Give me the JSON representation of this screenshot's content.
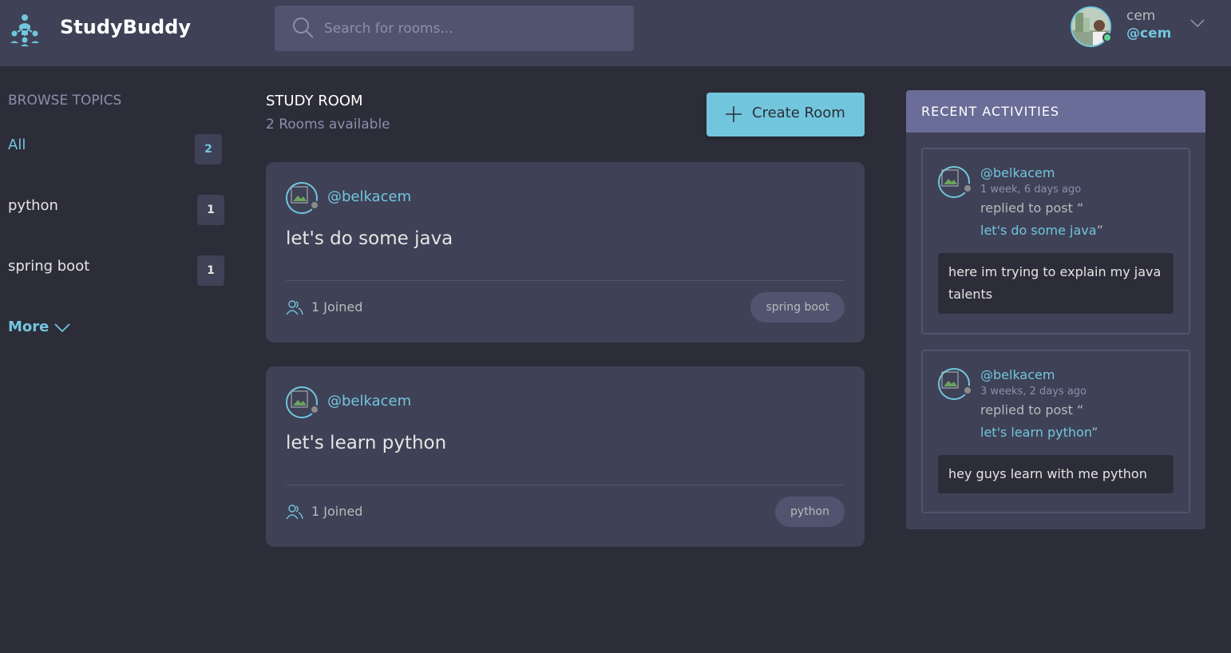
{
  "header": {
    "brand": "StudyBuddy",
    "search_placeholder": "Search for rooms...",
    "user": {
      "name": "cem",
      "handle": "@cem"
    }
  },
  "sidebar": {
    "title": "BROWSE TOPICS",
    "topics": [
      {
        "label": "All",
        "count": "2"
      },
      {
        "label": "python",
        "count": "1"
      },
      {
        "label": "spring boot",
        "count": "1"
      }
    ],
    "more_label": "More"
  },
  "main": {
    "title": "STUDY ROOM",
    "subtitle": "2 Rooms available",
    "create_label": "Create Room",
    "rooms": [
      {
        "host": "@belkacem",
        "name": "let's do some java",
        "joined": "1 Joined",
        "topic": "spring boot"
      },
      {
        "host": "@belkacem",
        "name": "let's learn python",
        "joined": "1 Joined",
        "topic": "python"
      }
    ]
  },
  "activities": {
    "title": "RECENT ACTIVITIES",
    "items": [
      {
        "user": "@belkacem",
        "time": "1 week, 6 days ago",
        "action": "replied to post “",
        "post": "let's do some java",
        "close": "”",
        "message": "here im trying to explain my java talents"
      },
      {
        "user": "@belkacem",
        "time": "3 weeks, 2 days ago",
        "action": "replied to post “",
        "post": "let's learn python",
        "close": "”",
        "message": "hey guys learn with me python"
      }
    ]
  },
  "colors": {
    "background": "#2d2d39",
    "surface": "#3f4156",
    "accent": "#71c6dd",
    "muted": "#8b8fab",
    "activities_header": "#696d97",
    "online": "#5dd693"
  }
}
